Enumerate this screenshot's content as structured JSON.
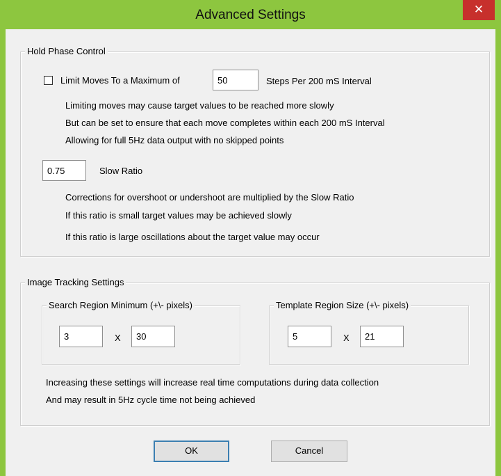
{
  "window": {
    "title": "Advanced Settings",
    "close_glyph": "✕",
    "accent_color": "#8dc63f",
    "close_color": "#c7302c"
  },
  "hold_phase": {
    "legend": "Hold Phase Control",
    "limit_checkbox_checked": false,
    "limit_label": "Limit Moves To a Maximum of",
    "max_steps_value": "50",
    "steps_suffix": "Steps Per 200 mS Interval",
    "info_lines": [
      "Limiting moves may cause target values to be reached more slowly",
      "But can be set to ensure that each move completes within each 200 mS Interval",
      "Allowing for full 5Hz data output with no skipped points"
    ],
    "slow_ratio_value": "0.75",
    "slow_ratio_label": "Slow Ratio",
    "ratio_lines": [
      "Corrections for overshoot or undershoot are multiplied by the Slow Ratio",
      "If this ratio is small target values may be achieved slowly",
      "If this ratio is large oscillations about the target value may occur"
    ]
  },
  "image_tracking": {
    "legend": "Image Tracking Settings",
    "search_region": {
      "legend": "Search Region Minimum (+\\- pixels)",
      "x_value": "3",
      "separator": "X",
      "y_value": "30"
    },
    "template_region": {
      "legend": "Template Region Size (+\\- pixels)",
      "x_value": "5",
      "separator": "X",
      "y_value": "21"
    },
    "note_lines": [
      "Increasing these settings will increase real time computations during data collection",
      "And may result in 5Hz cycle time not being achieved"
    ]
  },
  "buttons": {
    "ok": "OK",
    "cancel": "Cancel"
  }
}
